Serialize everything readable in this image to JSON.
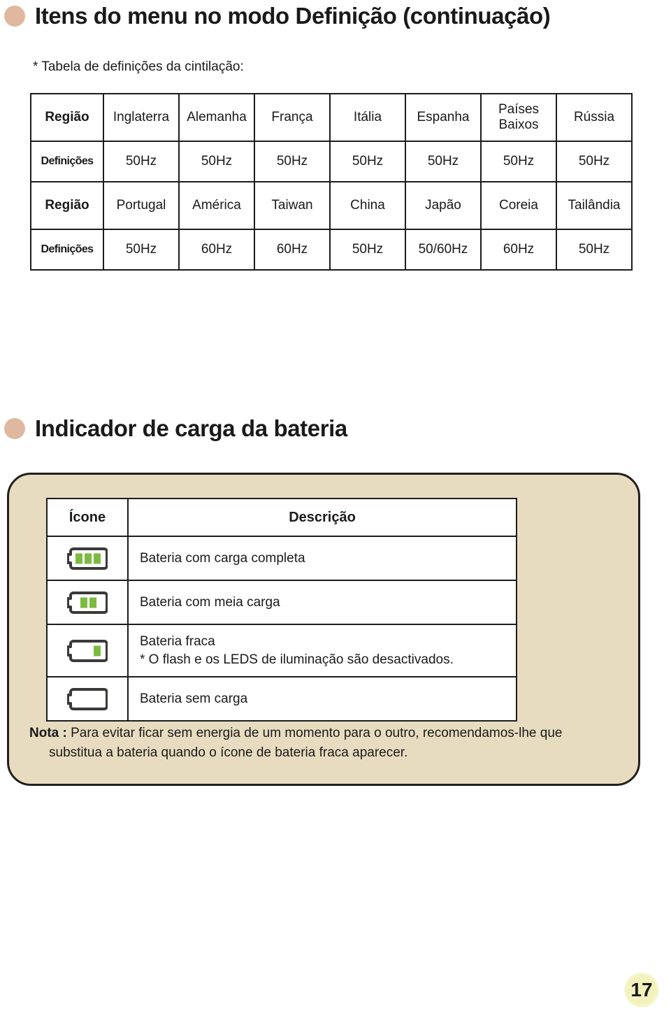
{
  "page": {
    "number": "17",
    "accent_bullet_color": "#e0b89f",
    "panel_color": "#e8dcc0",
    "battery_green": "#7cbb42"
  },
  "main_heading": {
    "bullet_icon": "round-bullet-icon",
    "title": "Itens do menu no modo Definição (continuação)"
  },
  "subcaption": "* Tabela de definições da cintilação:",
  "flicker_table": {
    "rows": [
      {
        "label": "Região",
        "label_type": "region",
        "cells": [
          "Inglaterra",
          "Alemanha",
          "França",
          "Itália",
          "Espanha",
          "Países Baixos",
          "Rússia"
        ]
      },
      {
        "label": "Definições",
        "label_type": "settings",
        "cells": [
          "50Hz",
          "50Hz",
          "50Hz",
          "50Hz",
          "50Hz",
          "50Hz",
          "50Hz"
        ]
      },
      {
        "label": "Região",
        "label_type": "region",
        "cells": [
          "Portugal",
          "América",
          "Taiwan",
          "China",
          "Japão",
          "Coreia",
          "Tailândia"
        ]
      },
      {
        "label": "Definições",
        "label_type": "settings",
        "cells": [
          "50Hz",
          "60Hz",
          "60Hz",
          "50Hz",
          "50/60Hz",
          "60Hz",
          "50Hz"
        ]
      }
    ]
  },
  "battery_heading": {
    "bullet_icon": "round-bullet-icon",
    "title": "Indicador de carga da bateria"
  },
  "battery_table": {
    "headers": {
      "icon": "Ícone",
      "description": "Descrição"
    },
    "rows": [
      {
        "icon_name": "battery-full-icon",
        "bars": 3,
        "desc_line1": "Bateria com carga completa",
        "desc_line2": ""
      },
      {
        "icon_name": "battery-half-icon",
        "bars": 2,
        "desc_line1": "Bateria com meia carga",
        "desc_line2": ""
      },
      {
        "icon_name": "battery-low-icon",
        "bars": 1,
        "desc_line1": "Bateria fraca",
        "desc_line2": "* O flash e os LEDS de iluminação são desactivados."
      },
      {
        "icon_name": "battery-empty-icon",
        "bars": 0,
        "desc_line1": "Bateria sem carga",
        "desc_line2": ""
      }
    ]
  },
  "note": {
    "label": "Nota :",
    "line1": " Para evitar ficar sem energia de um momento para o outro, recomendamos-lhe que",
    "line2": "substitua a bateria quando o ícone de bateria fraca aparecer."
  }
}
